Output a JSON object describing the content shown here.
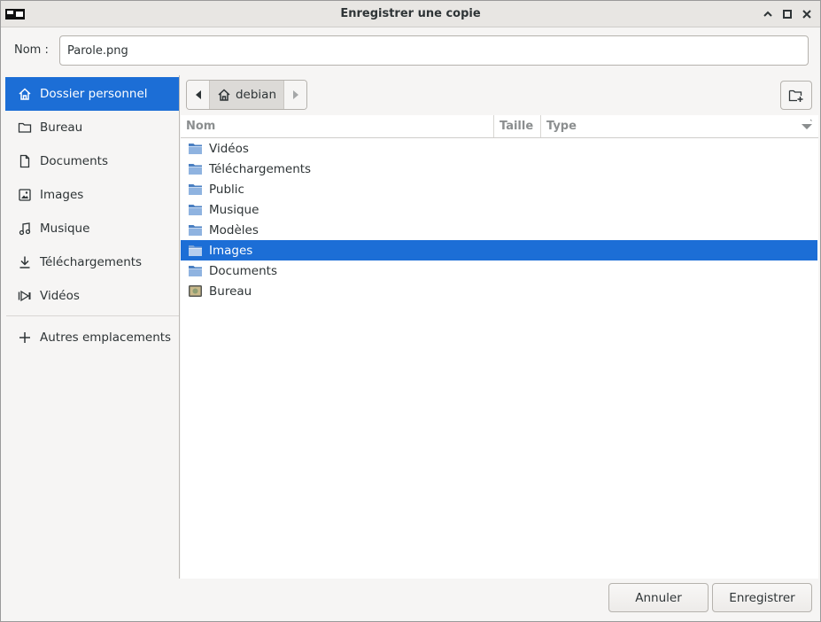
{
  "window": {
    "title": "Enregistrer une copie"
  },
  "name_field": {
    "label": "Nom :",
    "value": "Parole.png"
  },
  "sidebar": {
    "items": [
      {
        "label": "Dossier personnel",
        "icon": "home-icon",
        "active": true
      },
      {
        "label": "Bureau",
        "icon": "folder-icon"
      },
      {
        "label": "Documents",
        "icon": "document-icon"
      },
      {
        "label": "Images",
        "icon": "image-icon"
      },
      {
        "label": "Musique",
        "icon": "music-icon"
      },
      {
        "label": "Téléchargements",
        "icon": "download-icon"
      },
      {
        "label": "Vidéos",
        "icon": "video-icon"
      }
    ],
    "other_locations": {
      "label": "Autres emplacements",
      "icon": "plus-icon"
    }
  },
  "pathbar": {
    "current": "debian"
  },
  "file_list": {
    "columns": {
      "name": "Nom",
      "size": "Taille",
      "type": "Type"
    },
    "rows": [
      {
        "name": "Vidéos",
        "icon": "folder-icon"
      },
      {
        "name": "Téléchargements",
        "icon": "folder-icon"
      },
      {
        "name": "Public",
        "icon": "folder-icon"
      },
      {
        "name": "Musique",
        "icon": "folder-icon"
      },
      {
        "name": "Modèles",
        "icon": "folder-icon"
      },
      {
        "name": "Images",
        "icon": "folder-icon",
        "selected": true
      },
      {
        "name": "Documents",
        "icon": "folder-icon"
      },
      {
        "name": "Bureau",
        "icon": "desktop-icon"
      }
    ]
  },
  "buttons": {
    "cancel": "Annuler",
    "save": "Enregistrer"
  },
  "colors": {
    "accent": "#1c6ed6"
  }
}
